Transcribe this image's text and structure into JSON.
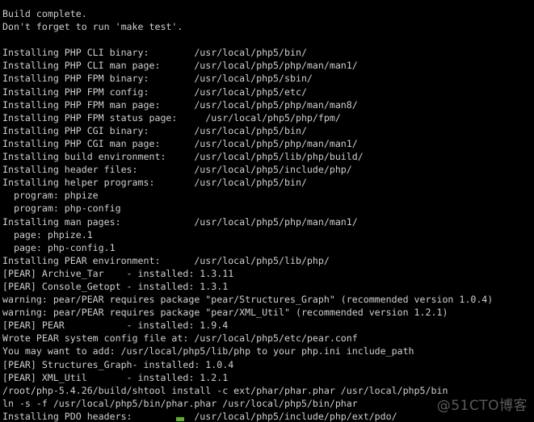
{
  "terminal": {
    "background_color": "#000000",
    "text_color": "#cfcfcf",
    "cursor_color": "#5ab220",
    "title": "php5 make install output",
    "lines": [
      "Build complete.",
      "Don't forget to run 'make test'.",
      "",
      "Installing PHP CLI binary:        /usr/local/php5/bin/",
      "Installing PHP CLI man page:      /usr/local/php5/php/man/man1/",
      "Installing PHP FPM binary:        /usr/local/php5/sbin/",
      "Installing PHP FPM config:        /usr/local/php5/etc/",
      "Installing PHP FPM man page:      /usr/local/php5/php/man/man8/",
      "Installing PHP FPM status page:     /usr/local/php5/php/fpm/",
      "Installing PHP CGI binary:        /usr/local/php5/bin/",
      "Installing PHP CGI man page:      /usr/local/php5/php/man/man1/",
      "Installing build environment:     /usr/local/php5/lib/php/build/",
      "Installing header files:          /usr/local/php5/include/php/",
      "Installing helper programs:       /usr/local/php5/bin/",
      "  program: phpize",
      "  program: php-config",
      "Installing man pages:             /usr/local/php5/php/man/man1/",
      "  page: phpize.1",
      "  page: php-config.1",
      "Installing PEAR environment:      /usr/local/php5/lib/php/",
      "[PEAR] Archive_Tar    - installed: 1.3.11",
      "[PEAR] Console_Getopt - installed: 1.3.1",
      "warning: pear/PEAR requires package \"pear/Structures_Graph\" (recommended version 1.0.4)",
      "warning: pear/PEAR requires package \"pear/XML_Util\" (recommended version 1.2.1)",
      "[PEAR] PEAR           - installed: 1.9.4",
      "Wrote PEAR system config file at: /usr/local/php5/etc/pear.conf",
      "You may want to add: /usr/local/php5/lib/php to your php.ini include_path",
      "[PEAR] Structures_Graph- installed: 1.0.4",
      "[PEAR] XML_Util       - installed: 1.2.1",
      "/root/php-5.4.26/build/shtool install -c ext/phar/phar.phar /usr/local/php5/bin",
      "ln -s -f /usr/local/php5/bin/phar.phar /usr/local/php5/bin/phar",
      "Installing PDO headers:           /usr/local/php5/include/php/ext/pdo/"
    ]
  },
  "watermark": {
    "text": "@51CTO博客"
  }
}
